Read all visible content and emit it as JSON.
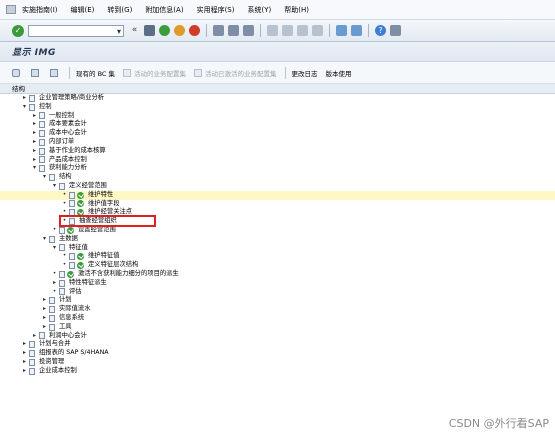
{
  "menubar": {
    "items": [
      "实施指南(I)",
      "编辑(E)",
      "转到(G)",
      "附加信息(A)",
      "实用程序(S)",
      "系统(Y)",
      "帮助(H)"
    ]
  },
  "toolbar": {
    "command_value": ""
  },
  "title": "显示 IMG",
  "app_toolbar": {
    "bc_set": "现有的 BC 集",
    "activity_bc": "活动的业务配置集",
    "activated_bc": "活动已激活的业务配置集",
    "change_log": "更改日志",
    "release_notes": "版本使用"
  },
  "tree": {
    "header": "结构",
    "rows": [
      {
        "indent": 0,
        "exp": "▸",
        "label": "企业管理策略/商业分析",
        "icon": "fold"
      },
      {
        "indent": 0,
        "exp": "▾",
        "label": "控制",
        "icon": "fold"
      },
      {
        "indent": 1,
        "exp": "▸",
        "label": "一般控制",
        "icon": "doc"
      },
      {
        "indent": 1,
        "exp": "▸",
        "label": "成本要素会计",
        "icon": "doc"
      },
      {
        "indent": 1,
        "exp": "▸",
        "label": "成本中心会计",
        "icon": "doc"
      },
      {
        "indent": 1,
        "exp": "▸",
        "label": "内部订单",
        "icon": "doc"
      },
      {
        "indent": 1,
        "exp": "▸",
        "label": "基于作业的成本核算",
        "icon": "doc"
      },
      {
        "indent": 1,
        "exp": "▸",
        "label": "产品成本控制",
        "icon": "doc"
      },
      {
        "indent": 1,
        "exp": "▾",
        "label": "获利能力分析",
        "icon": "doc"
      },
      {
        "indent": 2,
        "exp": "▾",
        "label": "结构",
        "icon": "doc"
      },
      {
        "indent": 3,
        "exp": "▾",
        "label": "定义经营范围",
        "icon": "doc"
      },
      {
        "indent": 4,
        "exp": "•",
        "label": "维护特性",
        "icon": "exec",
        "highlight": true
      },
      {
        "indent": 4,
        "exp": "•",
        "label": "维护值字段",
        "icon": "exec"
      },
      {
        "indent": 4,
        "exp": "•",
        "label": "维护经营关注点",
        "icon": "exec"
      },
      {
        "indent": 4,
        "exp": "•",
        "label": "抽查经营组织",
        "icon": "doc"
      },
      {
        "indent": 3,
        "exp": "•",
        "label": "设置经营范围",
        "icon": "exec"
      },
      {
        "indent": 2,
        "exp": "▾",
        "label": "主数据",
        "icon": "doc"
      },
      {
        "indent": 3,
        "exp": "▾",
        "label": "特征值",
        "icon": "doc"
      },
      {
        "indent": 4,
        "exp": "•",
        "label": "维护特征值",
        "icon": "exec"
      },
      {
        "indent": 4,
        "exp": "•",
        "label": "定义特征层次结构",
        "icon": "exec"
      },
      {
        "indent": 3,
        "exp": "•",
        "label": "激活不含获利能力细分的项目的派生",
        "icon": "exec"
      },
      {
        "indent": 3,
        "exp": "▸",
        "label": "特性特征派生",
        "icon": "doc"
      },
      {
        "indent": 3,
        "exp": "•",
        "label": "评估",
        "icon": "doc"
      },
      {
        "indent": 2,
        "exp": "▸",
        "label": "计划",
        "icon": "doc"
      },
      {
        "indent": 2,
        "exp": "▸",
        "label": "实际值流水",
        "icon": "doc"
      },
      {
        "indent": 2,
        "exp": "▸",
        "label": "信息系统",
        "icon": "doc"
      },
      {
        "indent": 2,
        "exp": "▸",
        "label": "工具",
        "icon": "doc"
      },
      {
        "indent": 1,
        "exp": "▸",
        "label": "利润中心会计",
        "icon": "doc"
      },
      {
        "indent": 0,
        "exp": "▸",
        "label": "计划与合并",
        "icon": "fold"
      },
      {
        "indent": 0,
        "exp": "▸",
        "label": "组报表的 SAP S/4HANA",
        "icon": "fold"
      },
      {
        "indent": 0,
        "exp": "▸",
        "label": "投资管理",
        "icon": "fold"
      },
      {
        "indent": 0,
        "exp": "▸",
        "label": "企业成本控制",
        "icon": "fold"
      }
    ]
  },
  "watermark": "CSDN @外行看SAP"
}
